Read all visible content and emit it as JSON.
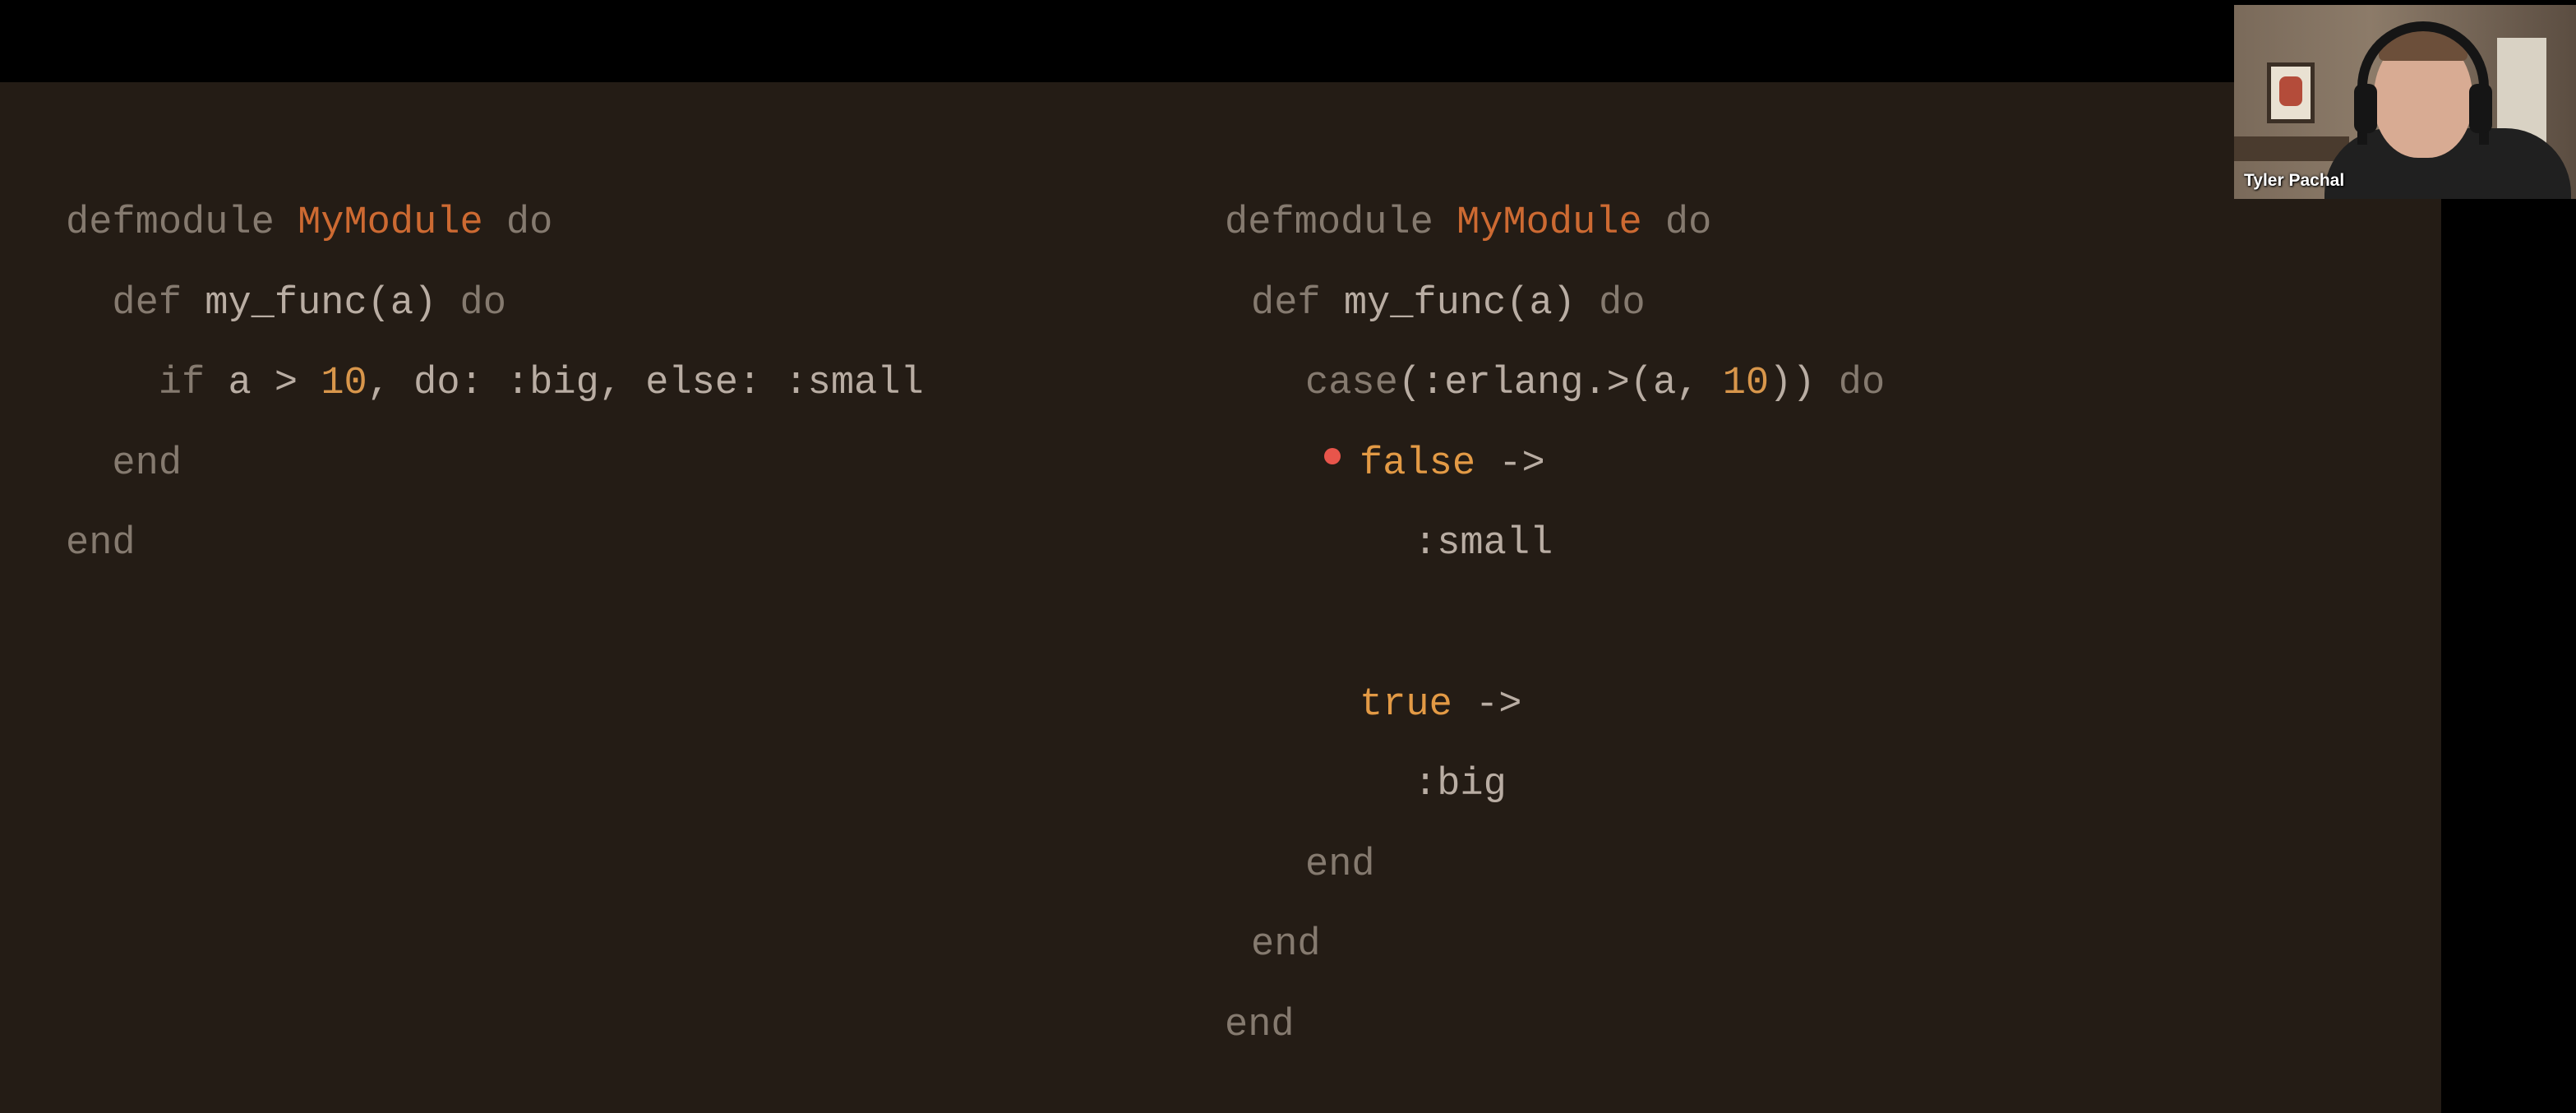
{
  "left_code": {
    "l1": {
      "kw1": "defmodule",
      "mod": "MyModule",
      "kw2": "do"
    },
    "l2": {
      "kw1": "def",
      "fn": "my_func(a)",
      "kw2": "do"
    },
    "l3": {
      "kw1": "if",
      "expr": "a >",
      "num": "10",
      "rest": ", do: :big, else: :small"
    },
    "l4": {
      "kw": "end"
    },
    "l5": {
      "kw": "end"
    }
  },
  "right_code": {
    "l1": {
      "kw1": "defmodule",
      "mod": "MyModule",
      "kw2": "do"
    },
    "l2": {
      "kw1": "def",
      "fn": "my_func(a)",
      "kw2": "do"
    },
    "l3": {
      "kw1": "case",
      "expr": "(:erlang.>(a,",
      "num": "10",
      "close": "))",
      "kw2": "do"
    },
    "l4": {
      "bool": "false",
      "arrow": "->"
    },
    "l5": {
      "atom": ":small"
    },
    "l6": {
      "bool": "true",
      "arrow": "->"
    },
    "l7": {
      "atom": ":big"
    },
    "l8": {
      "kw": "end"
    },
    "l9": {
      "kw": "end"
    },
    "l10": {
      "kw": "end"
    }
  },
  "participant": {
    "name": "Tyler Pachal"
  },
  "colors": {
    "slide_bg": "#241c15",
    "keyword": "#857a6f",
    "module": "#cd6a32",
    "identifier": "#b9ada3",
    "number": "#d8964b",
    "boolean": "#e39a45",
    "pointer_dot": "#e8554b"
  }
}
